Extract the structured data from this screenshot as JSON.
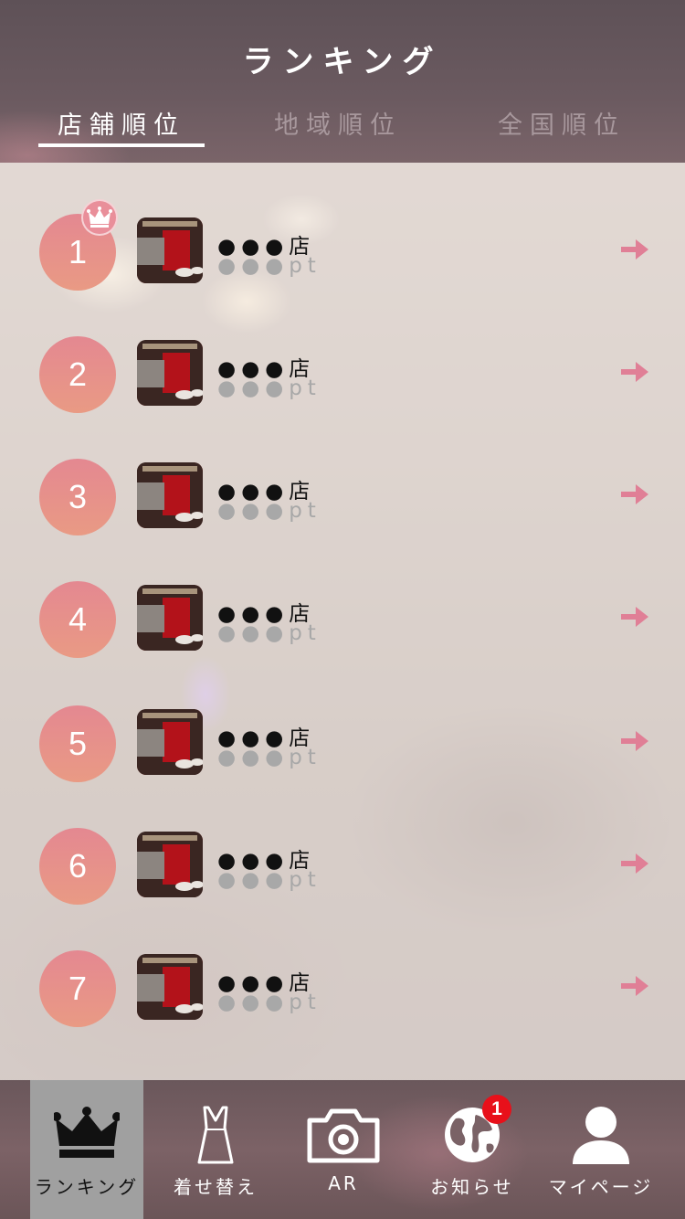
{
  "header": {
    "title": "ランキング",
    "tabs": [
      {
        "label": "店舗順位",
        "active": true
      },
      {
        "label": "地域順位",
        "active": false
      },
      {
        "label": "全国順位",
        "active": false
      }
    ]
  },
  "ranking": {
    "items": [
      {
        "rank": "1",
        "name": "●●●店",
        "points": "●●●pt",
        "crown": true
      },
      {
        "rank": "2",
        "name": "●●●店",
        "points": "●●●pt"
      },
      {
        "rank": "3",
        "name": "●●●店",
        "points": "●●●pt"
      },
      {
        "rank": "4",
        "name": "●●●店",
        "points": "●●●pt"
      },
      {
        "rank": "5",
        "name": "●●●店",
        "points": "●●●pt"
      },
      {
        "rank": "6",
        "name": "●●●店",
        "points": "●●●pt"
      },
      {
        "rank": "7",
        "name": "●●●店",
        "points": "●●●pt"
      }
    ]
  },
  "nav": {
    "items": [
      {
        "label": "ランキング",
        "icon": "crown-icon",
        "active": true
      },
      {
        "label": "着せ替え",
        "icon": "dress-icon"
      },
      {
        "label": "AR",
        "icon": "camera-icon"
      },
      {
        "label": "お知らせ",
        "icon": "globe-icon"
      },
      {
        "label": "マイページ",
        "icon": "person-icon"
      }
    ],
    "notification_count": "1"
  },
  "colors": {
    "accent": "#e48891",
    "arrow": "#e07f96",
    "header": "#5e5157",
    "badge": "#e8101a"
  }
}
